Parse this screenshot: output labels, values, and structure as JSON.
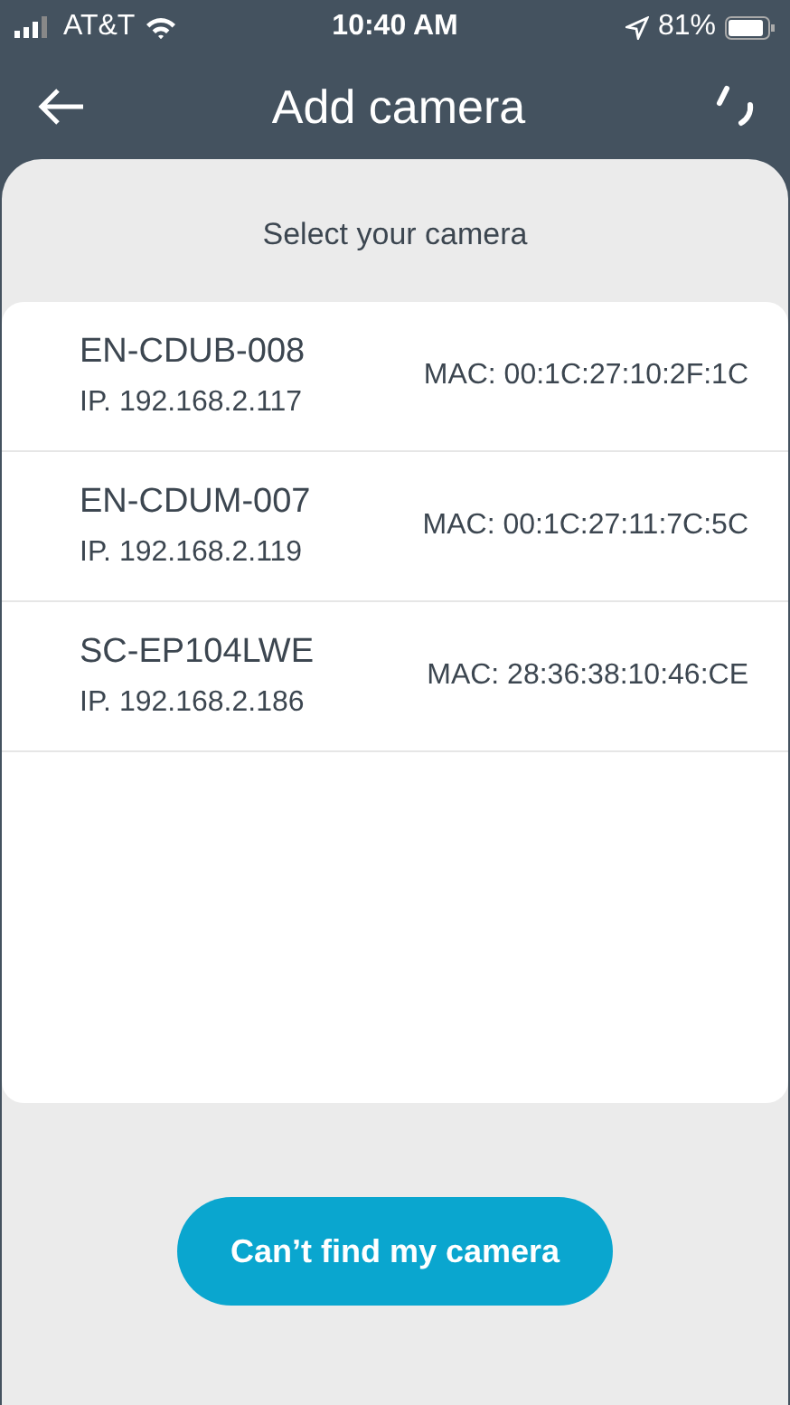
{
  "status_bar": {
    "carrier": "AT&T",
    "time": "10:40 AM",
    "battery": "81%"
  },
  "header": {
    "title": "Add camera"
  },
  "prompt": "Select your camera",
  "cameras": [
    {
      "name": "EN-CDUB-008",
      "ip": "IP. 192.168.2.117",
      "mac": "MAC: 00:1C:27:10:2F:1C"
    },
    {
      "name": "EN-CDUM-007",
      "ip": "IP. 192.168.2.119",
      "mac": "MAC: 00:1C:27:11:7C:5C"
    },
    {
      "name": "SC-EP104LWE",
      "ip": "IP. 192.168.2.186",
      "mac": "MAC: 28:36:38:10:46:CE"
    }
  ],
  "button": "Can’t find my camera"
}
